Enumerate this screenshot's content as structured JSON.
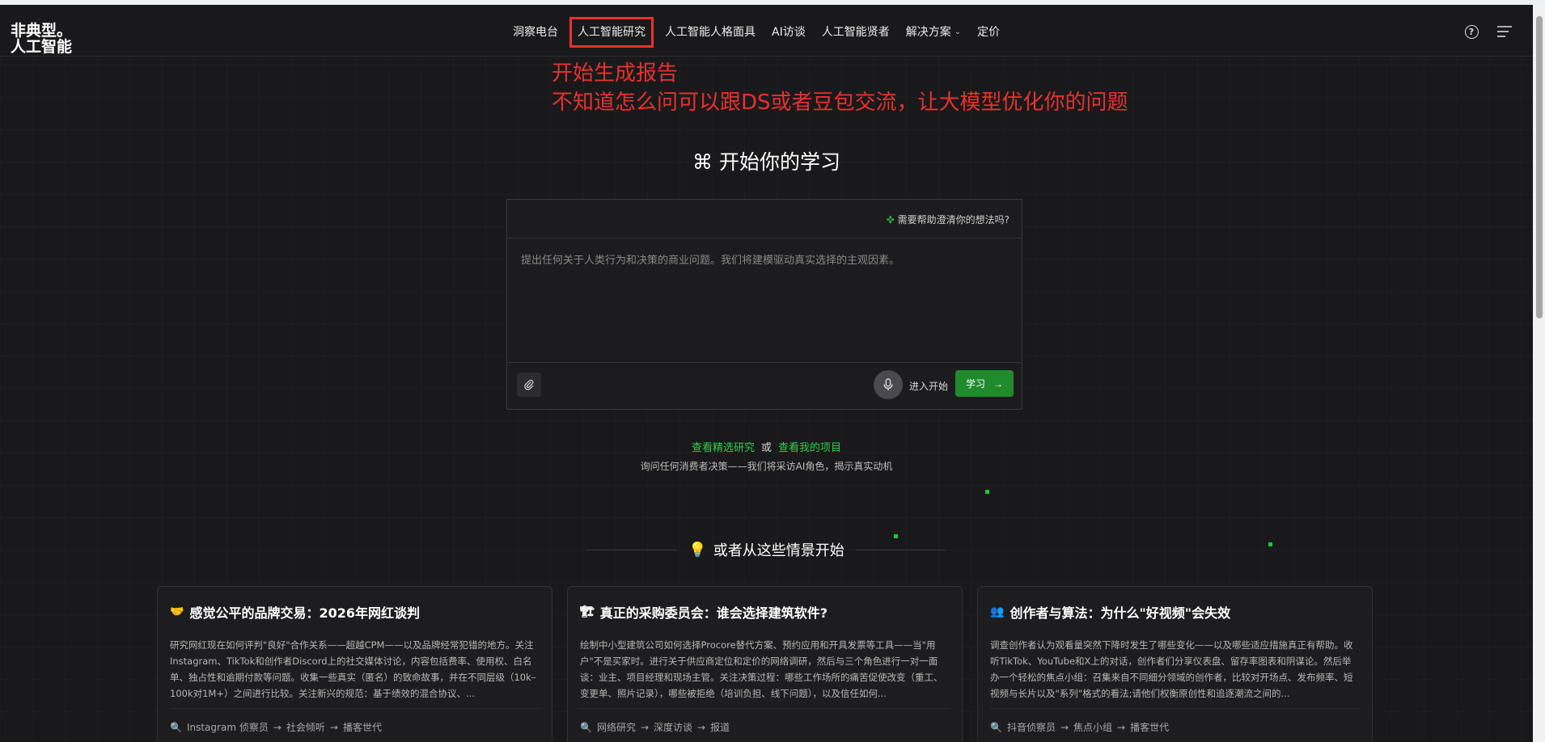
{
  "logo": {
    "line1": "非典型。",
    "line2": "人工智能"
  },
  "nav": {
    "items": [
      {
        "label": "洞察电台"
      },
      {
        "label": "人工智能研究"
      },
      {
        "label": "人工智能人格面具"
      },
      {
        "label": "AI访谈"
      },
      {
        "label": "人工智能贤者"
      },
      {
        "label": "解决方案"
      },
      {
        "label": "定价"
      }
    ]
  },
  "annotation": {
    "line1": "开始生成报告",
    "line2": "不知道怎么问可以跟DS或者豆包交流，让大模型优化你的问题"
  },
  "hero": {
    "title": "⌘ 开始你的学习"
  },
  "prompt": {
    "clarify": "需要帮助澄清你的想法吗?",
    "placeholder": "提出任何关于人类行为和决策的商业问题。我们将建模驱动真实选择的主观因素。",
    "enter_hint": "进入开始",
    "learn_label": "学习"
  },
  "links": {
    "featured": "查看精选研究",
    "or": "或",
    "my_projects": "查看我的项目",
    "subtitle": "询问任何消费者决策——我们将采访AI角色，揭示真实动机"
  },
  "section": {
    "title": "或者从这些情景开始"
  },
  "cards": [
    {
      "title": "感觉公平的品牌交易：2026年网红谈判",
      "desc": "研究网红现在如何评判\"良好\"合作关系——超越CPM——以及品牌经常犯错的地方。关注Instagram、TikTok和创作者Discord上的社交媒体讨论，内容包括费率、使用权、白名单、独占性和逾期付款等问题。收集一些真实（匿名）的致命故事，并在不同层级（10k–100k对1M+）之间进行比较。关注新兴的规范：基于绩效的混合协议、...",
      "flow": [
        "Instagram 侦察员",
        "社会倾听",
        "播客世代"
      ]
    },
    {
      "title": "真正的采购委员会：谁会选择建筑软件?",
      "desc": "绘制中小型建筑公司如何选择Procore替代方案、预约应用和开具发票等工具——当\"用户\"不是买家时。进行关于供应商定位和定价的网络调研，然后与三个角色进行一对一面谈：业主、项目经理和现场主管。关注决策过程：哪些工作场所的痛苦促使改变（重工、变更单、照片记录），哪些被拒绝（培训负担、线下问题），以及信任如何...",
      "flow": [
        "网络研究",
        "深度访谈",
        "报道"
      ]
    },
    {
      "title": "创作者与算法：为什么\"好视频\"会失效",
      "desc": "调查创作者认为观看量突然下降时发生了哪些变化——以及哪些适应措施真正有帮助。收听TikTok、YouTube和X上的对话，创作者们分享仪表盘、留存率图表和阴谋论。然后举办一个轻松的焦点小组：召集来自不同细分领域的创作者，比较对开场点、发布频率、短视频与长片以及\"系列\"格式的看法;请他们权衡原创性和追逐潮流之间的...",
      "flow": [
        "抖音侦察员",
        "焦点小组",
        "播客世代"
      ]
    }
  ],
  "colors": {
    "accent_green": "#2fd14d",
    "button_green": "#1f8b2c",
    "annotation_red": "#e8312e",
    "background": "#19191b"
  }
}
